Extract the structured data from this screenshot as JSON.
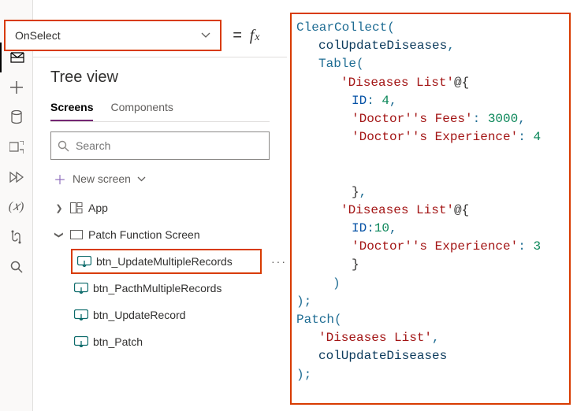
{
  "property_dropdown": {
    "value": "OnSelect"
  },
  "formula_tokens": {
    "fn_clearcollect": "ClearCollect",
    "fn_table": "Table",
    "fn_patch": "Patch",
    "id_col": "colUpdateDiseases",
    "str_diseases": "'Diseases List'",
    "at": "@",
    "prop_id": "ID",
    "prop_fees": "'Doctor''s Fees'",
    "prop_exp": "'Doctor''s Experience'",
    "num_4": "4",
    "num_3000": "3000",
    "num_4b": "4",
    "num_10": "10",
    "num_3": "3",
    "p_open": "(",
    "p_close": ")",
    "b_open": "{",
    "b_close": "}",
    "comma": ",",
    "colon_sp": ": ",
    "colon": ":",
    "semi": ";"
  },
  "tree_view": {
    "title": "Tree view",
    "tabs": {
      "screens": "Screens",
      "components": "Components"
    },
    "search_placeholder": "Search",
    "new_screen": "New screen",
    "app": "App",
    "patch_screen": "Patch Function Screen",
    "items": {
      "update_multi": "btn_UpdateMultipleRecords",
      "patch_multi": "btn_PacthMultipleRecords",
      "update_rec": "btn_UpdateRecord",
      "patch": "btn_Patch"
    },
    "more": "···"
  }
}
